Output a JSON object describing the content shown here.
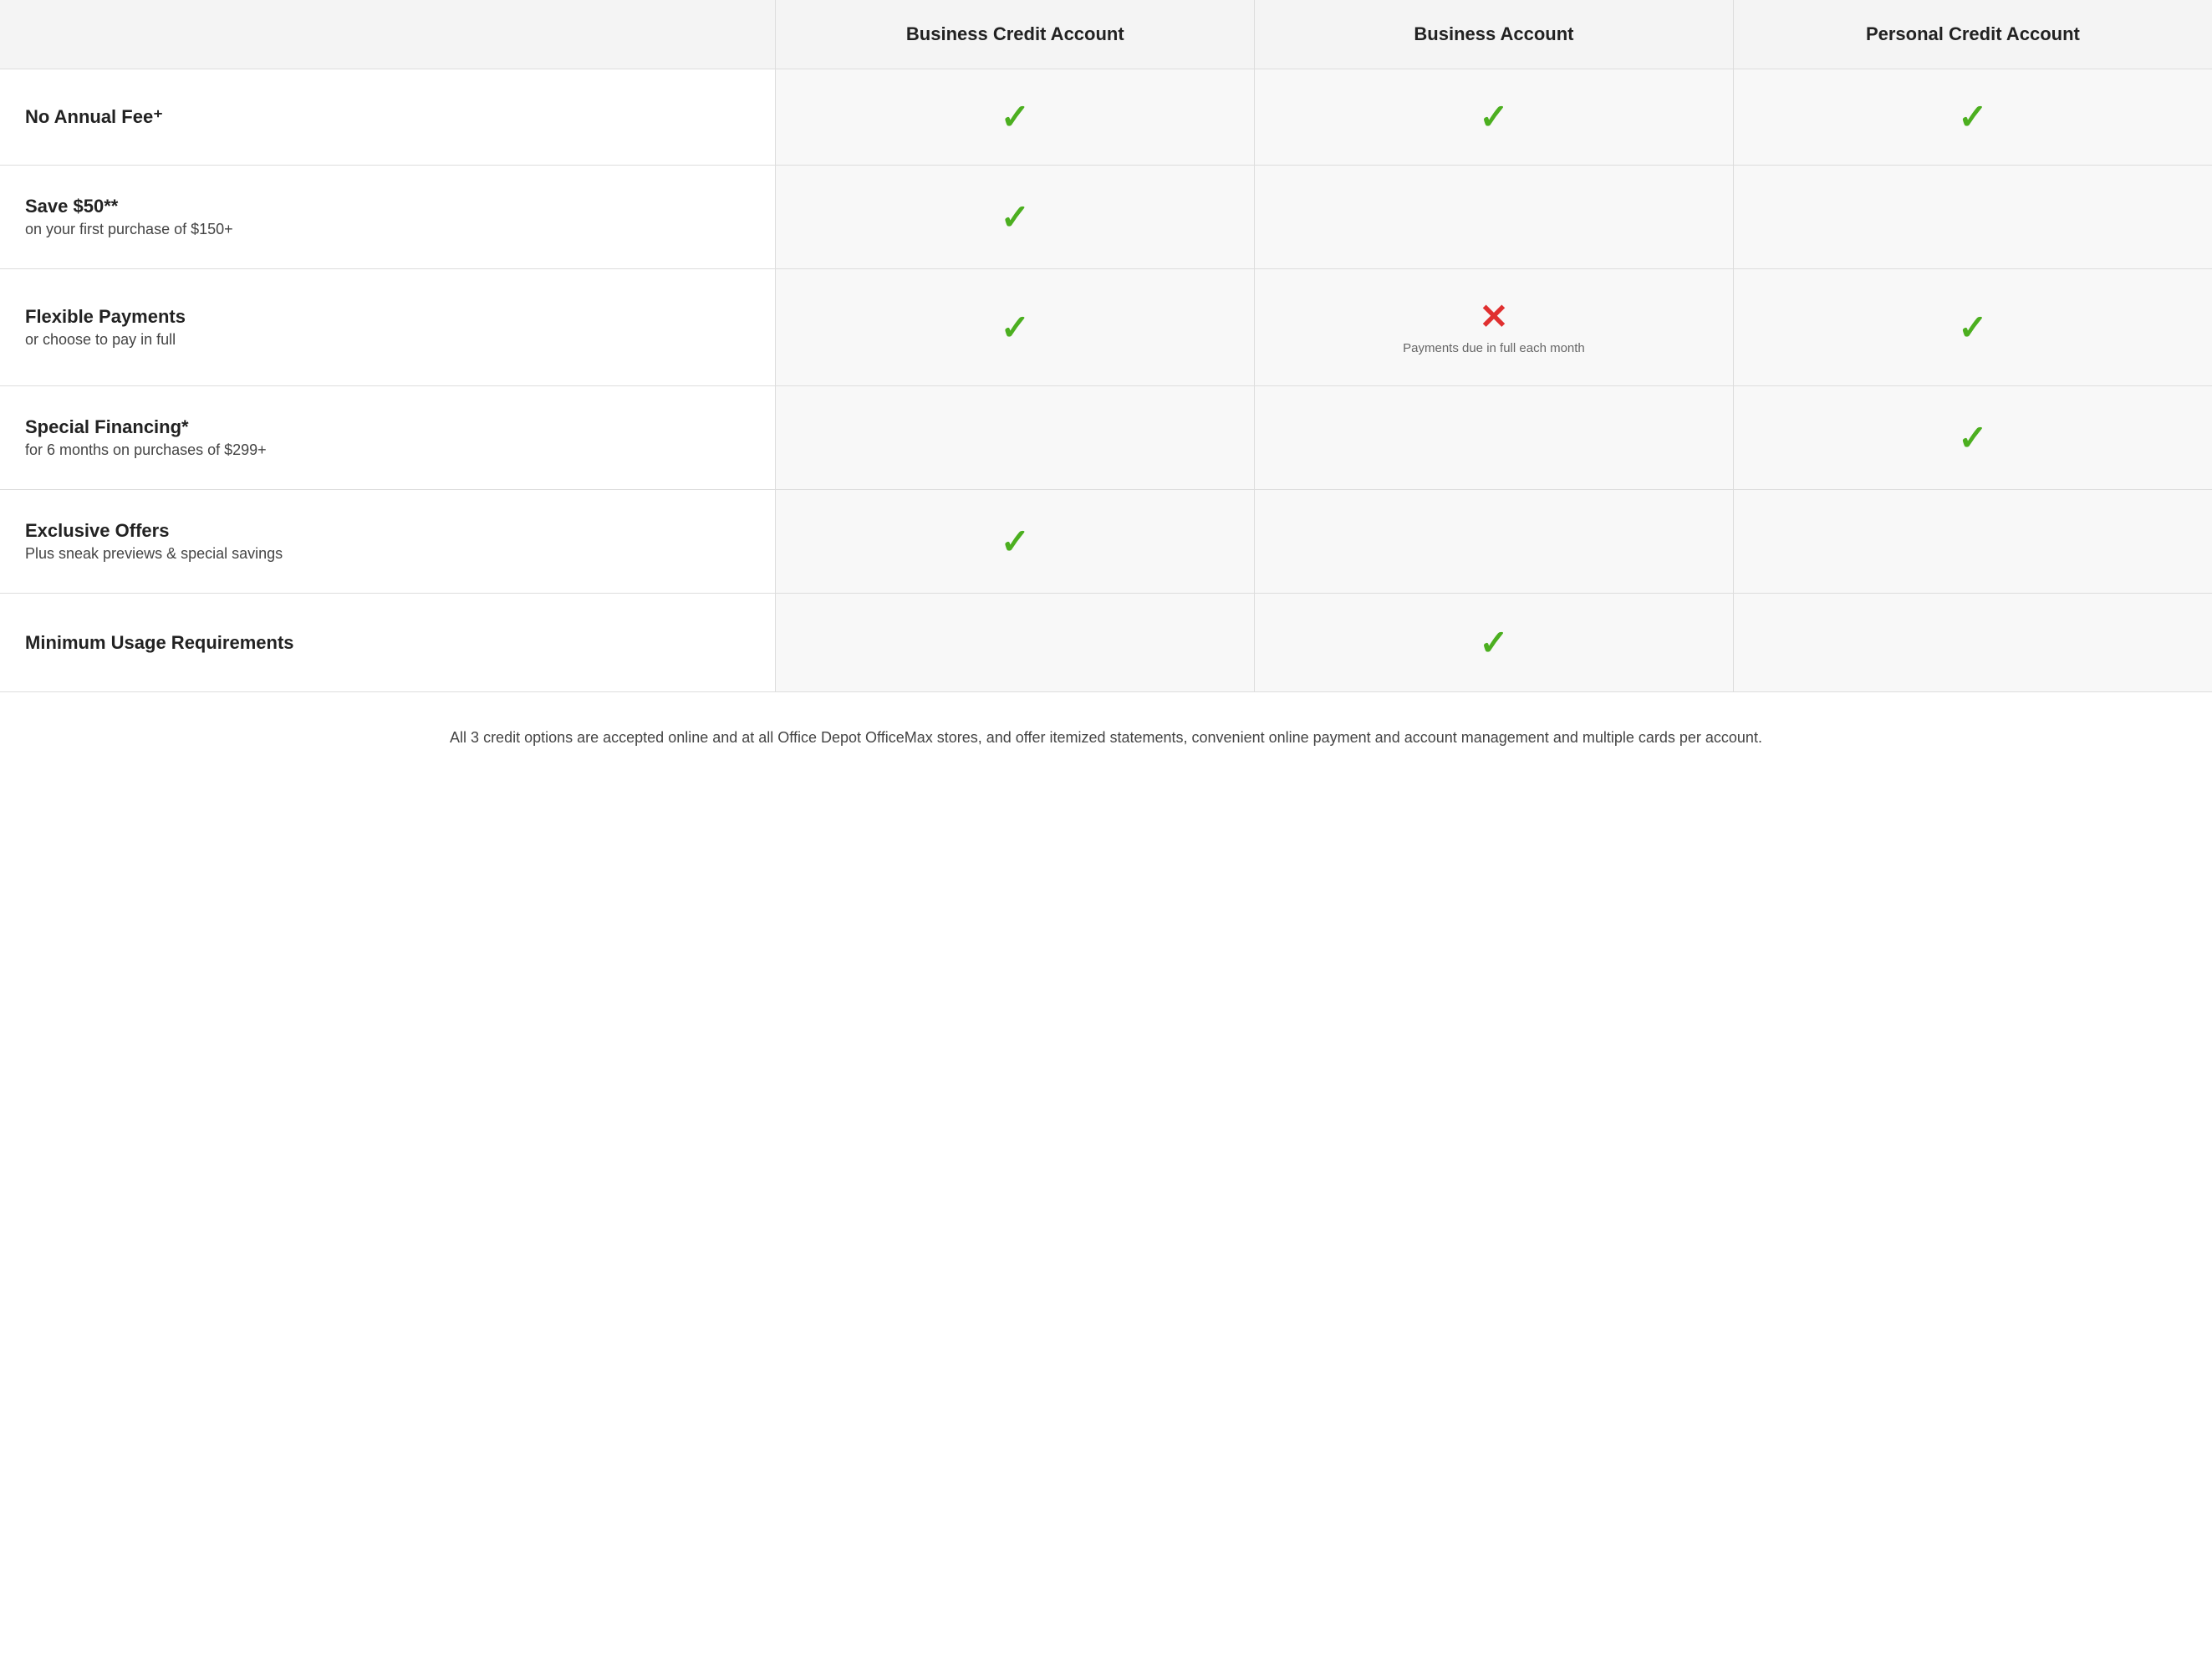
{
  "header": {
    "col1": "",
    "col2": "Business Credit Account",
    "col3": "Business Account",
    "col4": "Personal Credit Account"
  },
  "rows": [
    {
      "id": "no-annual-fee",
      "label": "No Annual Fee⁺",
      "sublabel": "",
      "col2": "check",
      "col3": "check",
      "col4": "check"
    },
    {
      "id": "save-50",
      "label": "Save $50**",
      "sublabel": "on your first purchase of $150+",
      "col2": "check",
      "col3": "empty",
      "col4": "empty"
    },
    {
      "id": "flexible-payments",
      "label": "Flexible Payments",
      "sublabel": "or choose to pay in full",
      "col2": "check",
      "col3": "cross",
      "col3note": "Payments due in full each month",
      "col4": "check"
    },
    {
      "id": "special-financing",
      "label": "Special Financing*",
      "sublabel": "for 6 months on purchases of $299+",
      "col2": "empty",
      "col3": "empty",
      "col4": "check"
    },
    {
      "id": "exclusive-offers",
      "label": "Exclusive Offers",
      "sublabel": "Plus sneak previews & special savings",
      "col2": "check",
      "col3": "empty",
      "col4": "empty"
    },
    {
      "id": "minimum-usage",
      "label": "Minimum Usage Requirements",
      "sublabel": "",
      "col2": "empty",
      "col3": "check",
      "col4": "empty"
    }
  ],
  "footer": {
    "note": "All 3 credit options are accepted online and at all Office Depot OfficeMax stores, and offer itemized statements, convenient online payment and account management and multiple cards per account."
  }
}
